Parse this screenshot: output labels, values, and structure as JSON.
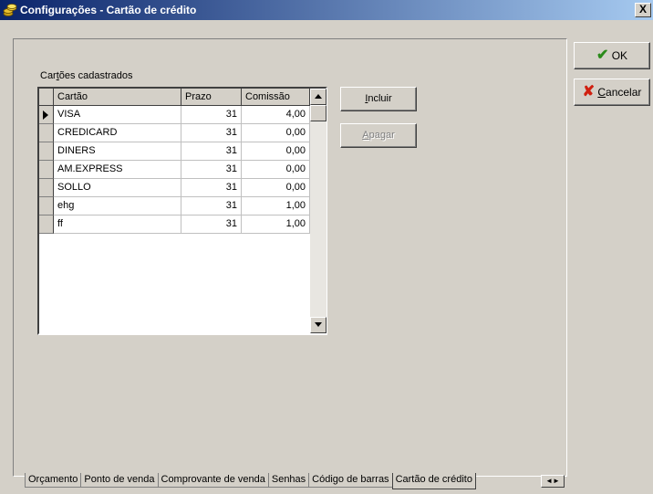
{
  "window": {
    "title": "Configurações - Cartão de crédito",
    "close_label": "X"
  },
  "group": {
    "label": "Cartões cadastrados"
  },
  "grid": {
    "columns": [
      "Cartão",
      "Prazo",
      "Comissão"
    ],
    "rows": [
      {
        "cartao": "VISA",
        "prazo": "31",
        "comissao": "4,00"
      },
      {
        "cartao": "CREDICARD",
        "prazo": "31",
        "comissao": "0,00"
      },
      {
        "cartao": "DINERS",
        "prazo": "31",
        "comissao": "0,00"
      },
      {
        "cartao": "AM.EXPRESS",
        "prazo": "31",
        "comissao": "0,00"
      },
      {
        "cartao": "SOLLO",
        "prazo": "31",
        "comissao": "0,00"
      },
      {
        "cartao": "ehg",
        "prazo": "31",
        "comissao": "1,00"
      },
      {
        "cartao": "ff",
        "prazo": "31",
        "comissao": "1,00"
      }
    ],
    "selected_row": 0
  },
  "buttons": {
    "incluir": "Incluir",
    "apagar": "Apagar",
    "ok": "OK",
    "cancelar": "Cancelar"
  },
  "tabs": [
    "Orçamento",
    "Ponto de venda",
    "Comprovante de venda",
    "Senhas",
    "Código de barras",
    "Cartão de crédito"
  ],
  "active_tab": 5,
  "icons": {
    "app": "coins-icon",
    "ok": "checkmark-icon",
    "cancel": "x-cross-icon"
  },
  "colors": {
    "titlebar_start": "#0a246a",
    "titlebar_end": "#a6caf0",
    "ok_check": "#2a8a1a",
    "cancel_x": "#d02010"
  }
}
